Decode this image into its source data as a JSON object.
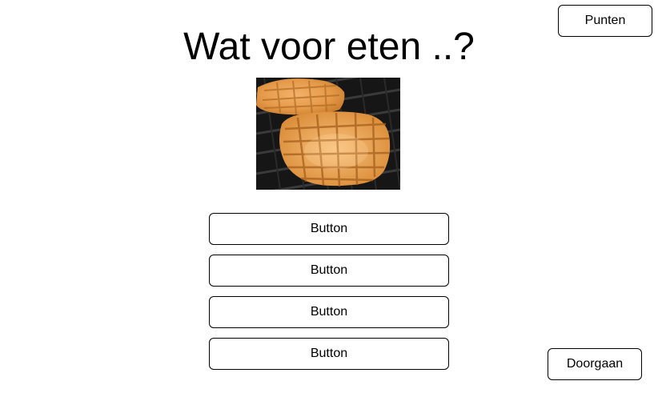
{
  "header": {
    "title": "Wat voor eten ..?",
    "score_button_label": "Punten"
  },
  "question": {
    "image_subject": "waffles-on-grill"
  },
  "answers": [
    {
      "label": "Button"
    },
    {
      "label": "Button"
    },
    {
      "label": "Button"
    },
    {
      "label": "Button"
    }
  ],
  "footer": {
    "continue_button_label": "Doorgaan"
  }
}
